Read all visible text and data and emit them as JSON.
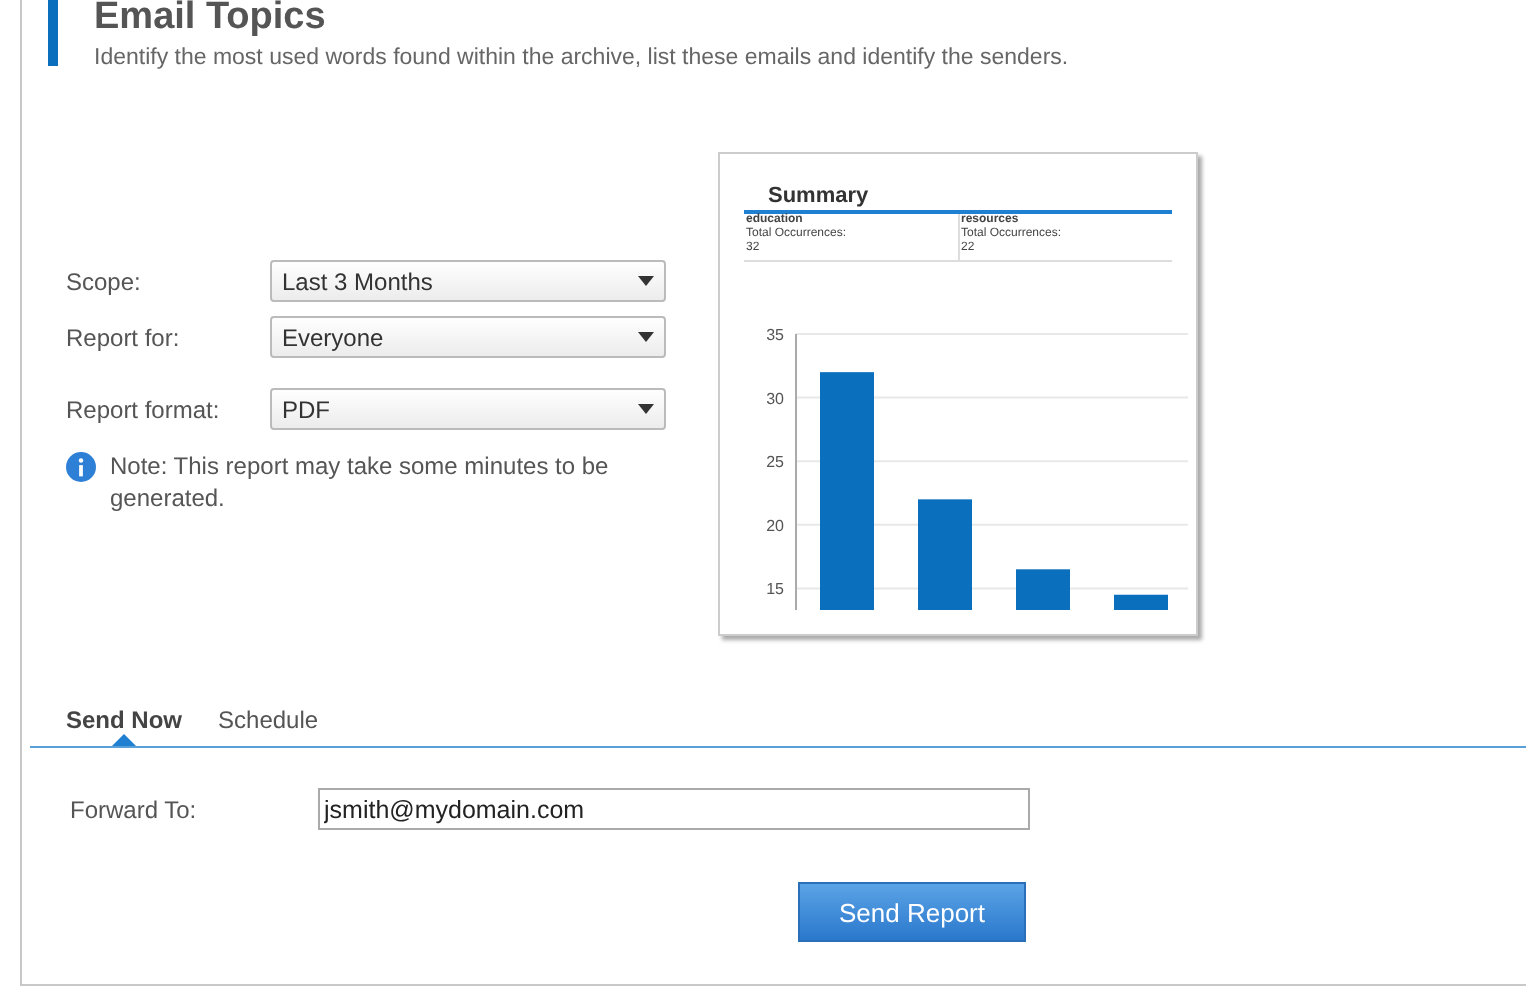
{
  "header": {
    "title": "Email Topics",
    "description": "Identify the most used words found within the archive, list these emails and identify the senders."
  },
  "form": [
    {
      "label": "Scope:",
      "value": "Last 3 Months"
    },
    {
      "label": "Report for:",
      "value": "Everyone"
    },
    {
      "label": "Report format:",
      "value": "PDF"
    }
  ],
  "note": "Note: This report may take some minutes to be generated.",
  "preview": {
    "title": "Summary",
    "summary": [
      {
        "word": "education",
        "caption": "Total Occurrences:",
        "count": "32"
      },
      {
        "word": "resources",
        "caption": "Total Occurrences:",
        "count": "22"
      }
    ],
    "chart_data": {
      "type": "bar",
      "values": [
        32,
        22,
        16.5,
        14.5
      ],
      "ylim": [
        13.3,
        35
      ],
      "yticks": [
        15,
        20,
        25,
        30,
        35
      ],
      "grid": true
    }
  },
  "tabs": [
    {
      "label": "Send Now",
      "selected": true
    },
    {
      "label": "Schedule",
      "selected": false
    }
  ],
  "forward": {
    "label": "Forward To:",
    "value": "jsmith@mydomain.com"
  },
  "send_button": "Send Report"
}
